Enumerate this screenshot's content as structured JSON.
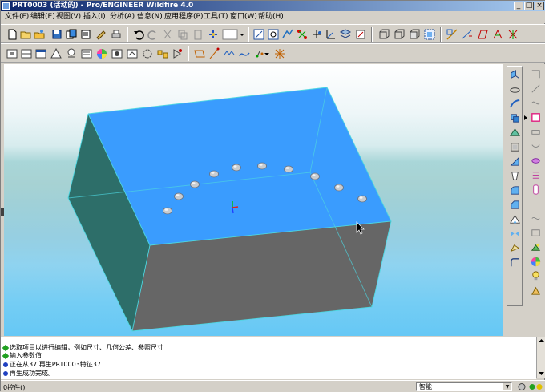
{
  "window": {
    "title": "PRT0003 (活动的) - Pro/ENGINEER Wildfire 4.0"
  },
  "menu": [
    "文件(F)",
    "编辑(E)",
    "视图(V)",
    "插入(I)",
    "分析(A)",
    "信息(N)",
    "应用程序(P)",
    "工具(T)",
    "窗口(W)",
    "帮助(H)"
  ],
  "toolbar1": [
    "new-icon",
    "open-icon",
    "open-folder-icon",
    "save-icon",
    "save-copy-icon",
    "print-icon",
    "send-icon",
    "printer-icon",
    "undo-icon",
    "redo-icon",
    "cut-icon",
    "copy-icon",
    "paste-icon",
    "regenerate-icon",
    "window-icon",
    "view-manager-icon",
    "zoom-fit-icon",
    "datum-display-icon",
    "datum-axis-icon",
    "datum-point-icon",
    "coord-sys-icon",
    "layers-icon",
    "repaint-icon",
    "orient-icon",
    "spin-icon",
    "annotation-icon",
    "plane-display-icon",
    "axis-display-icon",
    "point-display-icon",
    "csys-display-icon"
  ],
  "toolbar2": [
    "datum-plane-tool-icon",
    "datum-axis-tool-icon",
    "datum-curve-tool-icon",
    "datum-point-tool-icon",
    "csys-tool-icon",
    "appearance-icon",
    "shade-icon",
    "hidden-line-icon",
    "no-hidden-icon",
    "wireframe-icon",
    "model-tree-icon",
    "sketch-icon",
    "curve-icon",
    "line-icon",
    "wave-icon",
    "point-icon",
    "datum-star-icon"
  ],
  "rightbar_left": [
    "extrude-icon",
    "revolve-icon",
    "sweep-icon",
    "blend-icon",
    "hole-icon",
    "shell-icon",
    "rib-icon",
    "draft-icon",
    "round-icon",
    "chamfer-icon",
    "pattern-icon",
    "mirror-icon",
    "merge-icon",
    "trim-icon"
  ],
  "rightbar_right": [
    "fillet-icon",
    "edge-chamfer-icon",
    "curve-tool-icon",
    "box-icon",
    "cylinder-icon",
    "cone-icon",
    "torus-icon",
    "spring-icon",
    "shaft-icon",
    "flange-icon",
    "groove-icon",
    "slot-icon",
    "cut-icon",
    "ear-icon",
    "appearance-ball-icon",
    "lightbulb-icon",
    "pattern-table-icon"
  ],
  "messages": [
    {
      "icon": "green-diamond",
      "text": "选取项目以进行编辑，例如尺寸、几何公差、参照尺寸"
    },
    {
      "icon": "green-diamond",
      "text": "输入参数值"
    },
    {
      "icon": "blue-dot",
      "text": "正在从37 再生PRT0003特征37 ..."
    },
    {
      "icon": "blue-dot",
      "text": "再生成功完成。"
    }
  ],
  "status": {
    "left": "0控件()",
    "filter": "智能"
  },
  "colors": {
    "top_face": "#3a9cfe",
    "side_face": "#666666",
    "dark_side": "#2b6f68",
    "edge": "#4dd6e0"
  }
}
